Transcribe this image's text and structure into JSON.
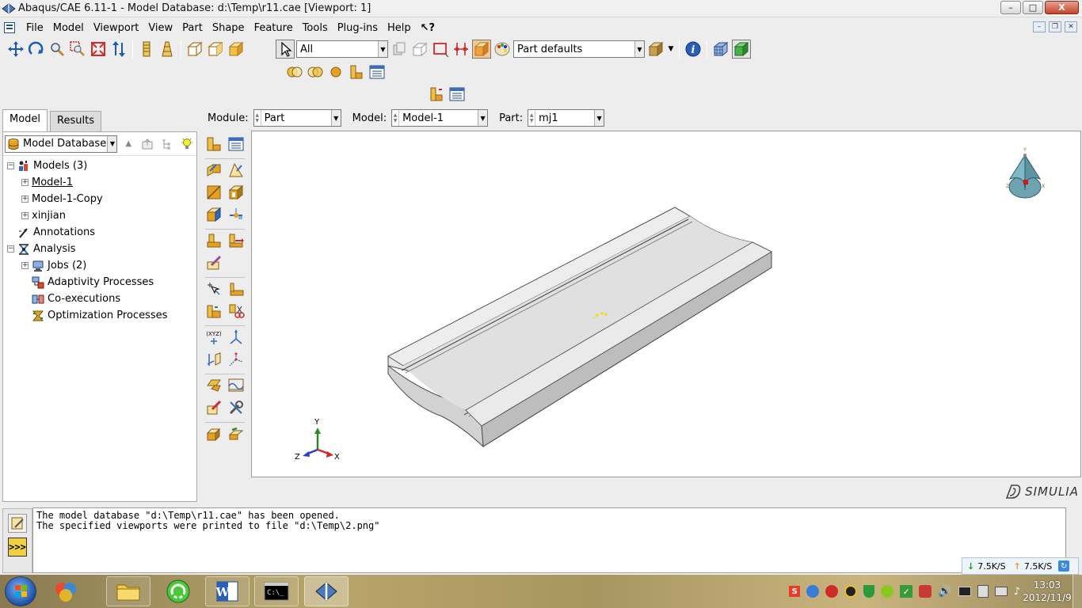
{
  "window": {
    "title": "Abaqus/CAE 6.11-1 - Model Database: d:\\Temp\\r11.cae [Viewport: 1]",
    "min": "–",
    "max": "□",
    "close": "X"
  },
  "menu": {
    "items": [
      "File",
      "Model",
      "Viewport",
      "View",
      "Part",
      "Shape",
      "Feature",
      "Tools",
      "Plug-ins",
      "Help"
    ],
    "help_cursor": "↖?"
  },
  "toolbar": {
    "selection_filter": "All",
    "render_style": "Part defaults"
  },
  "context": {
    "module_label": "Module:",
    "module_value": "Part",
    "model_label": "Model:",
    "model_value": "Model-1",
    "part_label": "Part:",
    "part_value": "mj1"
  },
  "left_panel": {
    "tabs": [
      "Model",
      "Results"
    ],
    "database": "Model Database",
    "tree": [
      {
        "label": "Models (3)",
        "level": 0,
        "expander": "−",
        "icon": "models-icon"
      },
      {
        "label": "Model-1",
        "level": 1,
        "expander": "+",
        "icon": ""
      },
      {
        "label": "Model-1-Copy",
        "level": 1,
        "expander": "+",
        "icon": ""
      },
      {
        "label": "xinjian",
        "level": 1,
        "expander": "+",
        "icon": ""
      },
      {
        "label": "Annotations",
        "level": 0,
        "expander": "",
        "icon": "annotations-icon"
      },
      {
        "label": "Analysis",
        "level": 0,
        "expander": "−",
        "icon": "analysis-icon"
      },
      {
        "label": "Jobs (2)",
        "level": 1,
        "expander": "+",
        "icon": "jobs-icon"
      },
      {
        "label": "Adaptivity Processes",
        "level": 1,
        "expander": "",
        "icon": "adaptivity-icon"
      },
      {
        "label": "Co-executions",
        "level": 1,
        "expander": "",
        "icon": "coexec-icon"
      },
      {
        "label": "Optimization Processes",
        "level": 1,
        "expander": "",
        "icon": "optimization-icon"
      }
    ]
  },
  "viewport": {
    "triad": {
      "y": "Y",
      "z": "Z",
      "x": "X"
    },
    "brand": "SIMULIA"
  },
  "messages": [
    "The model database \"d:\\Temp\\r11.cae\" has been opened.",
    "The specified viewports were printed to file \"d:\\Temp\\2.png\""
  ],
  "network": {
    "down": "7.5K/S",
    "up": "7.5K/S"
  },
  "clock": {
    "time": "13:03",
    "date": "2012/11/9"
  },
  "colors": {
    "accent": "#1f4e9a",
    "toolbox_orange": "#e0a030",
    "part_face": "#e2e2e2"
  }
}
